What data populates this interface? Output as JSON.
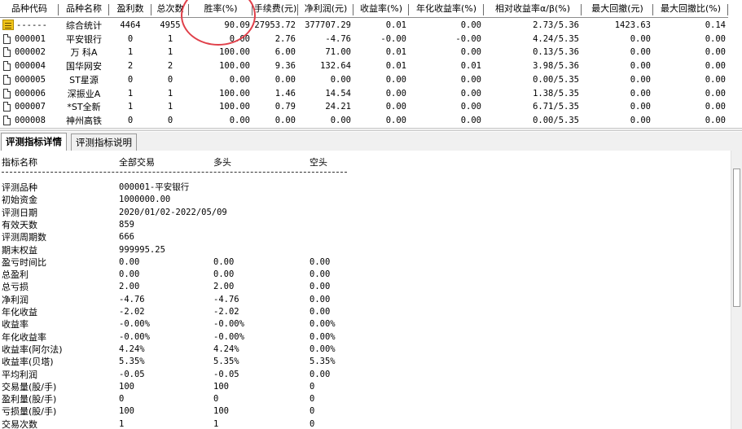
{
  "grid": {
    "headers": [
      "品种代码",
      "品种名称",
      "盈利数",
      "总次数",
      "胜率(%)",
      "手续费(元)",
      "净利润(元)",
      "收益率(%)",
      "年化收益率(%)",
      "相对收益率α/β(%)",
      "最大回撤(元)",
      "最大回撤比(%)"
    ],
    "rows": [
      {
        "code": "------",
        "name": "综合统计",
        "profit_count": "4464",
        "total_count": "4955",
        "win_rate": "90.09",
        "fee": "27953.72",
        "net_profit": "377707.29",
        "return_rate": "0.01",
        "annual_return": "0.00",
        "alpha_beta": "2.73/5.36",
        "max_drawdown": "1423.63",
        "max_drawdown_ratio": "0.14",
        "icon": "summary-icon"
      },
      {
        "code": "000001",
        "name": "平安银行",
        "profit_count": "0",
        "total_count": "1",
        "win_rate": "0.00",
        "fee": "2.76",
        "net_profit": "-4.76",
        "return_rate": "-0.00",
        "annual_return": "-0.00",
        "alpha_beta": "4.24/5.35",
        "max_drawdown": "0.00",
        "max_drawdown_ratio": "0.00",
        "icon": "document-icon"
      },
      {
        "code": "000002",
        "name": "万 科A",
        "profit_count": "1",
        "total_count": "1",
        "win_rate": "100.00",
        "fee": "6.00",
        "net_profit": "71.00",
        "return_rate": "0.01",
        "annual_return": "0.00",
        "alpha_beta": "0.13/5.36",
        "max_drawdown": "0.00",
        "max_drawdown_ratio": "0.00",
        "icon": "document-icon"
      },
      {
        "code": "000004",
        "name": "国华网安",
        "profit_count": "2",
        "total_count": "2",
        "win_rate": "100.00",
        "fee": "9.36",
        "net_profit": "132.64",
        "return_rate": "0.01",
        "annual_return": "0.01",
        "alpha_beta": "3.98/5.36",
        "max_drawdown": "0.00",
        "max_drawdown_ratio": "0.00",
        "icon": "document-icon"
      },
      {
        "code": "000005",
        "name": "ST星源",
        "profit_count": "0",
        "total_count": "0",
        "win_rate": "0.00",
        "fee": "0.00",
        "net_profit": "0.00",
        "return_rate": "0.00",
        "annual_return": "0.00",
        "alpha_beta": "0.00/5.35",
        "max_drawdown": "0.00",
        "max_drawdown_ratio": "0.00",
        "icon": "document-icon"
      },
      {
        "code": "000006",
        "name": "深振业A",
        "profit_count": "1",
        "total_count": "1",
        "win_rate": "100.00",
        "fee": "1.46",
        "net_profit": "14.54",
        "return_rate": "0.00",
        "annual_return": "0.00",
        "alpha_beta": "1.38/5.35",
        "max_drawdown": "0.00",
        "max_drawdown_ratio": "0.00",
        "icon": "document-icon"
      },
      {
        "code": "000007",
        "name": "*ST全新",
        "profit_count": "1",
        "total_count": "1",
        "win_rate": "100.00",
        "fee": "0.79",
        "net_profit": "24.21",
        "return_rate": "0.00",
        "annual_return": "0.00",
        "alpha_beta": "6.71/5.35",
        "max_drawdown": "0.00",
        "max_drawdown_ratio": "0.00",
        "icon": "document-icon"
      },
      {
        "code": "000008",
        "name": "神州高铁",
        "profit_count": "0",
        "total_count": "0",
        "win_rate": "0.00",
        "fee": "0.00",
        "net_profit": "0.00",
        "return_rate": "0.00",
        "annual_return": "0.00",
        "alpha_beta": "0.00/5.35",
        "max_drawdown": "0.00",
        "max_drawdown_ratio": "0.00",
        "icon": "document-icon"
      }
    ]
  },
  "tabs": [
    "评测指标详情",
    "评测指标说明"
  ],
  "detail": {
    "header": [
      "指标名称",
      "全部交易",
      "多头",
      "空头"
    ],
    "rows": [
      [
        "评测品种",
        "000001-平安银行",
        "",
        ""
      ],
      [
        "初始资金",
        "1000000.00",
        "",
        ""
      ],
      [
        "评测日期",
        "2020/01/02-2022/05/09",
        "",
        ""
      ],
      [
        "有效天数",
        "859",
        "",
        ""
      ],
      [
        "评测周期数",
        "666",
        "",
        ""
      ],
      [
        "期末权益",
        "999995.25",
        "",
        ""
      ],
      [
        "盈亏时间比",
        "0.00",
        "0.00",
        "0.00"
      ],
      [
        "总盈利",
        "0.00",
        "0.00",
        "0.00"
      ],
      [
        "总亏损",
        "2.00",
        "2.00",
        "0.00"
      ],
      [
        "净利润",
        "-4.76",
        "-4.76",
        "0.00"
      ],
      [
        "年化收益",
        "-2.02",
        "-2.02",
        "0.00"
      ],
      [
        "收益率",
        "-0.00%",
        "-0.00%",
        "0.00%"
      ],
      [
        "年化收益率",
        "-0.00%",
        "-0.00%",
        "0.00%"
      ],
      [
        "收益率(阿尔法)",
        "4.24%",
        "4.24%",
        "0.00%"
      ],
      [
        "收益率(贝塔)",
        "5.35%",
        "5.35%",
        "5.35%"
      ],
      [
        "平均利润",
        "-0.05",
        "-0.05",
        "0.00"
      ],
      [
        "交易量(股/手)",
        "100",
        "100",
        "0"
      ],
      [
        "盈利量(股/手)",
        "0",
        "0",
        "0"
      ],
      [
        "亏损量(股/手)",
        "100",
        "100",
        "0"
      ],
      [
        "交易次数",
        "1",
        "1",
        "0"
      ]
    ]
  },
  "annotation": {
    "color": "#e0404a"
  }
}
